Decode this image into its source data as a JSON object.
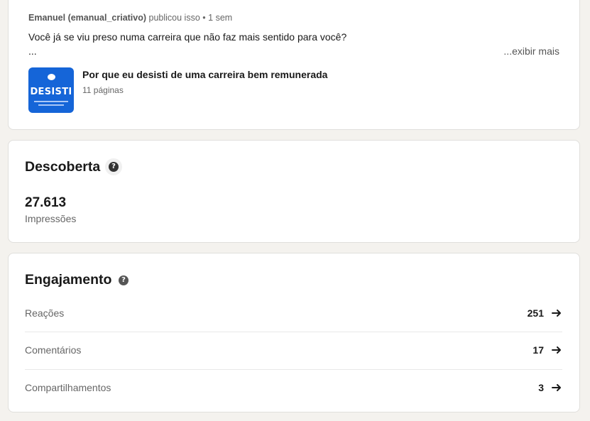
{
  "post": {
    "author_name": "Emanuel (emanual_criativo)",
    "action": "publicou isso",
    "separator": "•",
    "time": "1 sem",
    "text": "Você já se viu preso numa carreira que não faz mais sentido para você?",
    "ellipsis": "...",
    "see_more": "...exibir mais",
    "document": {
      "thumbnail_text": "DESISTI",
      "title": "Por que eu desisti de uma carreira bem remunerada",
      "pages": "11 páginas"
    }
  },
  "discovery": {
    "title": "Descoberta",
    "help_icon": "question-circle-icon",
    "impressions_value": "27.613",
    "impressions_label": "Impressões"
  },
  "engagement": {
    "title": "Engajamento",
    "help_icon": "question-circle-icon",
    "rows": [
      {
        "label": "Reações",
        "value": "251",
        "icon": "arrow-right-icon"
      },
      {
        "label": "Comentários",
        "value": "17",
        "icon": "arrow-right-icon"
      },
      {
        "label": "Compartilhamentos",
        "value": "3",
        "icon": "arrow-right-icon"
      }
    ]
  },
  "colors": {
    "background": "#f4f2ee",
    "card": "#ffffff",
    "document_thumb": "#1565d8"
  }
}
